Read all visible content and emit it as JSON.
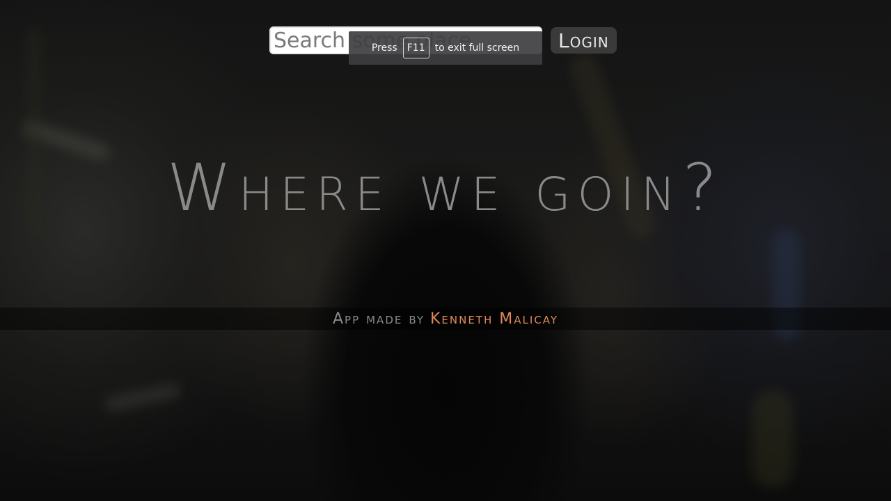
{
  "search": {
    "placeholder": "Search some place"
  },
  "header": {
    "login_label": "Login"
  },
  "fullscreen_toast": {
    "prefix": "Press",
    "key": "F11",
    "suffix": "to exit full screen"
  },
  "hero": {
    "headline": "Where we goin?"
  },
  "footer": {
    "prefix": "App made by",
    "author": "Kenneth Malicay"
  },
  "colors": {
    "headline": "#8a8a8a",
    "author_accent": "#e08a5a",
    "login_bg": "#3a3a3a"
  }
}
